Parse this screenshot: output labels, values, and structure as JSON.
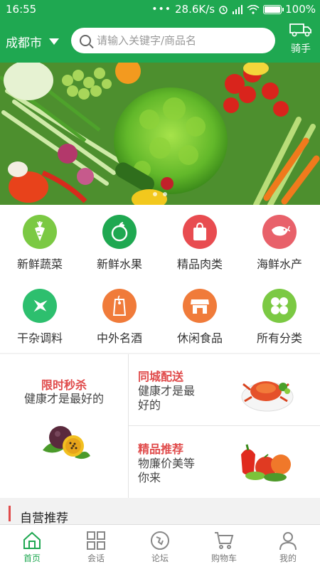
{
  "status": {
    "time": "16:55",
    "network": "28.6K/s",
    "battery": "100%"
  },
  "header": {
    "city": "成都市",
    "search_placeholder": "请输入关键字/商品名",
    "rider_label": "骑手"
  },
  "categories": [
    {
      "label": "新鲜蔬菜",
      "icon": "carrot-icon",
      "color": "#7bc943"
    },
    {
      "label": "新鲜水果",
      "icon": "apple-icon",
      "color": "#1fa851"
    },
    {
      "label": "精品肉类",
      "icon": "meat-bag-icon",
      "color": "#e84c50"
    },
    {
      "label": "海鲜水产",
      "icon": "shrimp-icon",
      "color": "#e8616a"
    },
    {
      "label": "干杂调料",
      "icon": "airplane-icon",
      "color": "#2dbf6e"
    },
    {
      "label": "中外名酒",
      "icon": "tag-icon",
      "color": "#f07b3a"
    },
    {
      "label": "休闲食品",
      "icon": "shop-icon",
      "color": "#f07b3a"
    },
    {
      "label": "所有分类",
      "icon": "grid-all-icon",
      "color": "#7bc943"
    }
  ],
  "promo": {
    "flash": {
      "title": "限时秒杀",
      "subtitle": "健康才是最好的"
    },
    "delivery": {
      "title": "同城配送",
      "subtitle_line1": "健康才是最",
      "subtitle_line2": "好的"
    },
    "recommend": {
      "title": "精品推荐",
      "subtitle_line1": "物廉价美等",
      "subtitle_line2": "你来"
    }
  },
  "section": {
    "title": "自营推荐"
  },
  "nav": [
    {
      "label": "首页",
      "icon": "home-icon",
      "active": true
    },
    {
      "label": "会话",
      "icon": "chat-grid-icon",
      "active": false
    },
    {
      "label": "论坛",
      "icon": "forum-icon",
      "active": false
    },
    {
      "label": "购物车",
      "icon": "cart-icon",
      "active": false
    },
    {
      "label": "我的",
      "icon": "user-icon",
      "active": false
    }
  ],
  "colors": {
    "brand_green": "#1fa851",
    "accent_red": "#e04a4a"
  }
}
